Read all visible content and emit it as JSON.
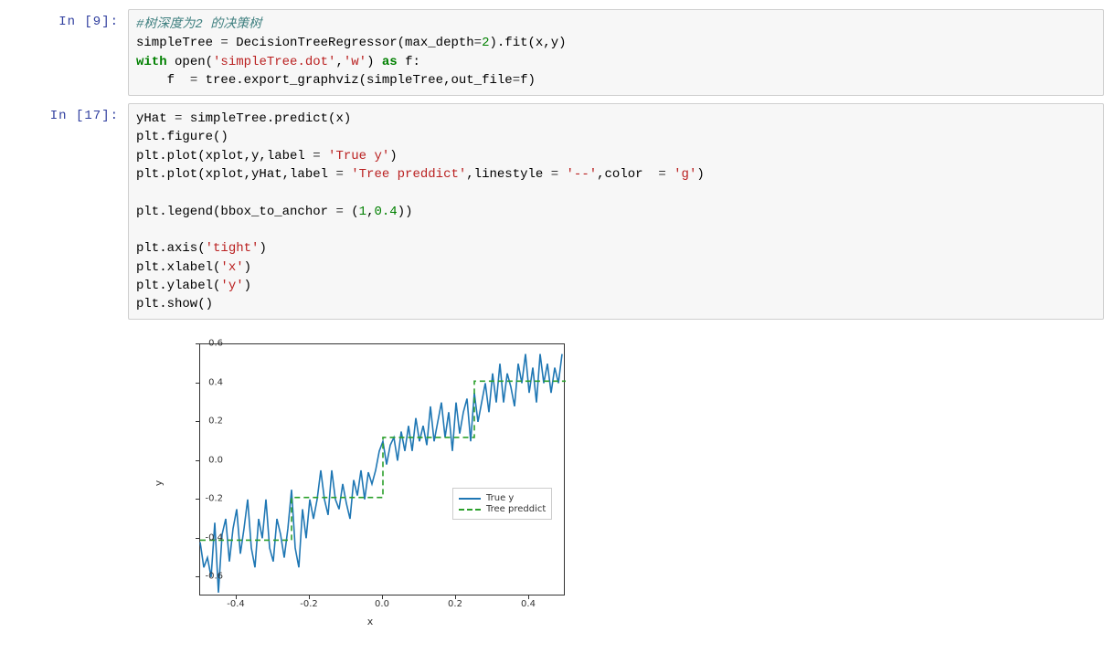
{
  "cells": {
    "c1": {
      "prompt": "In  [9]:"
    },
    "c2": {
      "prompt": "In [17]:"
    }
  },
  "code1": {
    "comment": "#树深度为2 的决策树",
    "l2a": "simpleTree ",
    "l2b": "=",
    "l2c": " DecisionTreeRegressor(max_depth",
    "l2d": "=",
    "l2e": "2",
    "l2f": ").fit(x,y)",
    "l3a": "with",
    "l3b": " open(",
    "l3c": "'simpleTree.dot'",
    "l3d": ",",
    "l3e": "'w'",
    "l3f": ") ",
    "l3g": "as",
    "l3h": " f:",
    "l4a": "    f  ",
    "l4b": "=",
    "l4c": " tree.export_graphviz(simpleTree,out_file",
    "l4d": "=",
    "l4e": "f)"
  },
  "code2": {
    "l1a": "yHat ",
    "l1b": "=",
    "l1c": " simpleTree.predict(x)",
    "l2": "plt.figure()",
    "l3a": "plt.plot(xplot,y,label ",
    "l3b": "=",
    "l3c": " ",
    "l3d": "'True y'",
    "l3e": ")",
    "l4a": "plt.plot(xplot,yHat,label ",
    "l4b": "=",
    "l4c": " ",
    "l4d": "'Tree preddict'",
    "l4e": ",linestyle ",
    "l4f": "=",
    "l4g": " ",
    "l4h": "'--'",
    "l4i": ",color  ",
    "l4j": "=",
    "l4k": " ",
    "l4l": "'g'",
    "l4m": ")",
    "blank": "",
    "l5a": "plt.legend(bbox_to_anchor ",
    "l5b": "=",
    "l5c": " (",
    "l5d": "1",
    "l5e": ",",
    "l5f": "0.4",
    "l5g": "))",
    "l6a": "plt.axis(",
    "l6b": "'tight'",
    "l6c": ")",
    "l7a": "plt.xlabel(",
    "l7b": "'x'",
    "l7c": ")",
    "l8a": "plt.ylabel(",
    "l8b": "'y'",
    "l8c": ")",
    "l9": "plt.show()"
  },
  "chart_data": {
    "type": "line",
    "xlabel": "x",
    "ylabel": "y",
    "xlim": [
      -0.5,
      0.5
    ],
    "ylim": [
      -0.7,
      0.6
    ],
    "xticks": [
      -0.4,
      -0.2,
      0.0,
      0.2,
      0.4
    ],
    "yticks": [
      -0.6,
      -0.4,
      -0.2,
      0.0,
      0.2,
      0.4,
      0.6
    ],
    "xtick_labels": [
      "-0.4",
      "-0.2",
      "0.0",
      "0.2",
      "0.4"
    ],
    "ytick_labels": [
      "-0.6",
      "-0.4",
      "-0.2",
      "0.0",
      "0.2",
      "0.4",
      "0.6"
    ],
    "legend": {
      "entries": [
        "True y",
        "Tree preddict"
      ],
      "position": "right"
    },
    "series": [
      {
        "name": "True y",
        "style": "solid",
        "color": "#1f77b4",
        "x": [
          -0.5,
          -0.49,
          -0.48,
          -0.47,
          -0.46,
          -0.45,
          -0.44,
          -0.43,
          -0.42,
          -0.41,
          -0.4,
          -0.39,
          -0.38,
          -0.37,
          -0.36,
          -0.35,
          -0.34,
          -0.33,
          -0.32,
          -0.31,
          -0.3,
          -0.29,
          -0.28,
          -0.27,
          -0.26,
          -0.25,
          -0.24,
          -0.23,
          -0.22,
          -0.21,
          -0.2,
          -0.19,
          -0.18,
          -0.17,
          -0.16,
          -0.15,
          -0.14,
          -0.13,
          -0.12,
          -0.11,
          -0.1,
          -0.09,
          -0.08,
          -0.07,
          -0.06,
          -0.05,
          -0.04,
          -0.03,
          -0.02,
          -0.01,
          0.0,
          0.01,
          0.02,
          0.03,
          0.04,
          0.05,
          0.06,
          0.07,
          0.08,
          0.09,
          0.1,
          0.11,
          0.12,
          0.13,
          0.14,
          0.15,
          0.16,
          0.17,
          0.18,
          0.19,
          0.2,
          0.21,
          0.22,
          0.23,
          0.24,
          0.25,
          0.26,
          0.27,
          0.28,
          0.29,
          0.3,
          0.31,
          0.32,
          0.33,
          0.34,
          0.35,
          0.36,
          0.37,
          0.38,
          0.39,
          0.4,
          0.41,
          0.42,
          0.43,
          0.44,
          0.45,
          0.46,
          0.47,
          0.48,
          0.49
        ],
        "y": [
          -0.42,
          -0.55,
          -0.5,
          -0.6,
          -0.32,
          -0.68,
          -0.38,
          -0.3,
          -0.52,
          -0.35,
          -0.25,
          -0.48,
          -0.35,
          -0.2,
          -0.45,
          -0.55,
          -0.3,
          -0.4,
          -0.2,
          -0.45,
          -0.52,
          -0.3,
          -0.38,
          -0.5,
          -0.35,
          -0.15,
          -0.45,
          -0.55,
          -0.25,
          -0.4,
          -0.2,
          -0.3,
          -0.2,
          -0.05,
          -0.2,
          -0.28,
          -0.05,
          -0.2,
          -0.25,
          -0.12,
          -0.22,
          -0.3,
          -0.1,
          -0.18,
          -0.05,
          -0.2,
          -0.06,
          -0.12,
          -0.05,
          0.05,
          0.1,
          -0.02,
          0.08,
          0.12,
          0.0,
          0.15,
          0.05,
          0.18,
          0.05,
          0.22,
          0.1,
          0.18,
          0.08,
          0.28,
          0.1,
          0.2,
          0.3,
          0.12,
          0.25,
          0.05,
          0.3,
          0.14,
          0.25,
          0.32,
          0.1,
          0.35,
          0.2,
          0.3,
          0.4,
          0.25,
          0.45,
          0.3,
          0.5,
          0.3,
          0.45,
          0.38,
          0.28,
          0.5,
          0.4,
          0.55,
          0.35,
          0.48,
          0.3,
          0.55,
          0.4,
          0.5,
          0.35,
          0.48,
          0.4,
          0.55
        ]
      },
      {
        "name": "Tree preddict",
        "style": "dashed",
        "color": "#2ca02c",
        "x": [
          -0.5,
          -0.25,
          -0.25,
          0.0,
          0.0,
          0.25,
          0.25,
          0.5
        ],
        "y": [
          -0.41,
          -0.41,
          -0.19,
          -0.19,
          0.12,
          0.12,
          0.41,
          0.41
        ]
      }
    ]
  }
}
